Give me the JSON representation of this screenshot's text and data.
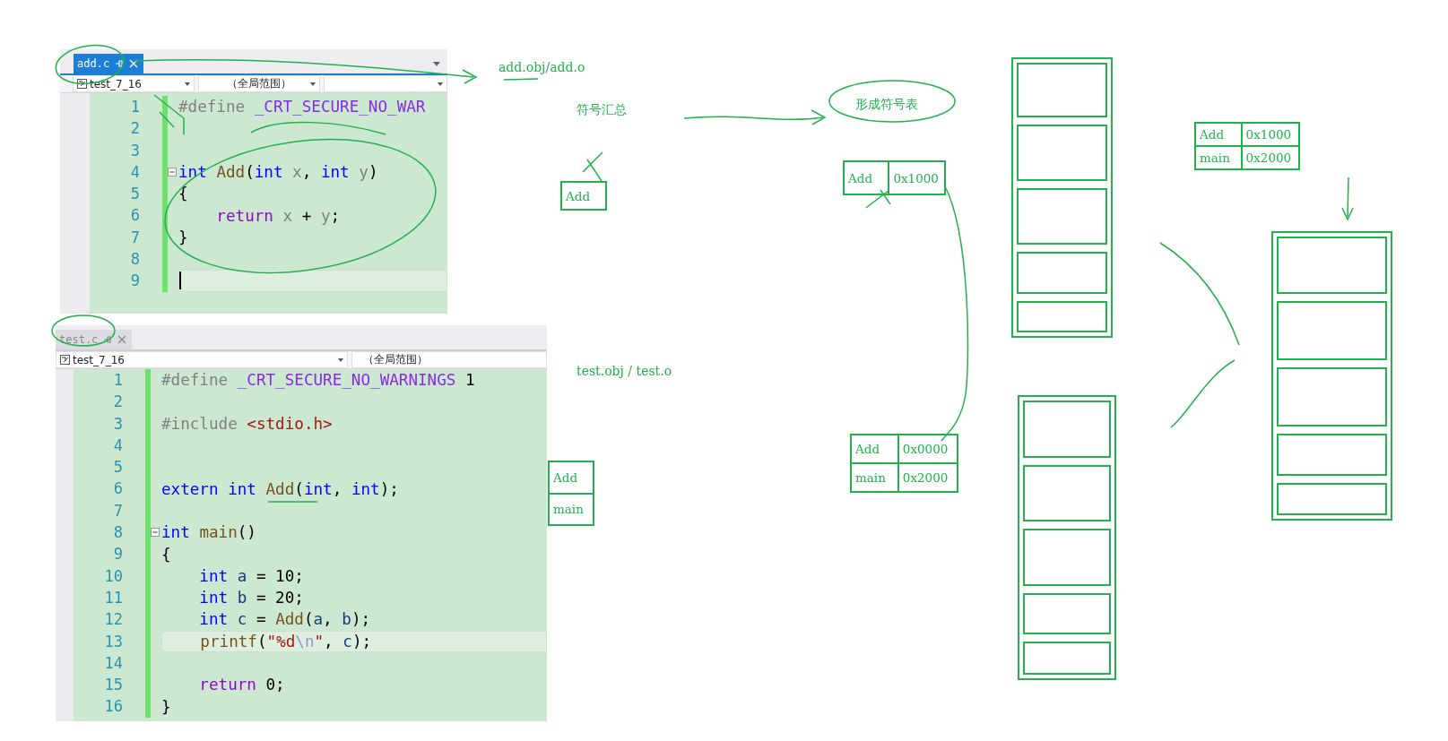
{
  "editors": [
    {
      "tab": {
        "label": "add.c",
        "selected": true
      },
      "project": "test_7_16",
      "scope": "（全局范围）",
      "third_dropdown": true,
      "lines": [
        {
          "number": "1",
          "tokens": [
            {
              "text": "#define ",
              "kind": "pre"
            },
            {
              "text": "_CRT_SECURE_NO_WAR",
              "kind": "macro"
            }
          ]
        },
        {
          "number": "2"
        },
        {
          "number": "3"
        },
        {
          "number": "4",
          "fold": true,
          "tokens": [
            {
              "text": "int ",
              "kind": "kw"
            },
            {
              "text": "Add",
              "kind": "fn"
            },
            {
              "text": "(",
              "kind": "plain"
            },
            {
              "text": "int",
              "kind": "kw"
            },
            {
              "text": " x",
              "kind": "param"
            },
            {
              "text": ", ",
              "kind": "plain"
            },
            {
              "text": "int",
              "kind": "kw"
            },
            {
              "text": " y",
              "kind": "param"
            },
            {
              "text": ")",
              "kind": "plain"
            }
          ]
        },
        {
          "number": "5",
          "tokens": [
            {
              "text": "{",
              "kind": "plain"
            }
          ]
        },
        {
          "number": "6",
          "tokens": [
            {
              "text": "    return",
              "kind": "ctl"
            },
            {
              "text": " x",
              "kind": "param"
            },
            {
              "text": " + ",
              "kind": "plain"
            },
            {
              "text": "y",
              "kind": "param"
            },
            {
              "text": ";",
              "kind": "plain"
            }
          ]
        },
        {
          "number": "7",
          "tokens": [
            {
              "text": "}",
              "kind": "plain"
            }
          ]
        },
        {
          "number": "8"
        },
        {
          "number": "9",
          "current": true
        }
      ]
    },
    {
      "tab": {
        "label": "test.c",
        "selected": false
      },
      "project": "test_7_16",
      "scope": "（全局范围）",
      "third_dropdown": false,
      "lines": [
        {
          "number": "1",
          "tokens": [
            {
              "text": "#define ",
              "kind": "pre"
            },
            {
              "text": "_CRT_SECURE_NO_WARNINGS",
              "kind": "macro"
            },
            {
              "text": " 1",
              "kind": "plain"
            }
          ]
        },
        {
          "number": "2"
        },
        {
          "number": "3",
          "tokens": [
            {
              "text": "#include ",
              "kind": "pre"
            },
            {
              "text": "<stdio.h>",
              "kind": "str"
            }
          ]
        },
        {
          "number": "4"
        },
        {
          "number": "5"
        },
        {
          "number": "6",
          "tokens": [
            {
              "text": "extern ",
              "kind": "kw"
            },
            {
              "text": "int ",
              "kind": "kw"
            },
            {
              "text": "Add",
              "kind": "fn"
            },
            {
              "text": "(",
              "kind": "plain"
            },
            {
              "text": "int",
              "kind": "kw"
            },
            {
              "text": ", ",
              "kind": "plain"
            },
            {
              "text": "int",
              "kind": "kw"
            },
            {
              "text": ");",
              "kind": "plain"
            }
          ]
        },
        {
          "number": "7"
        },
        {
          "number": "8",
          "fold": true,
          "tokens": [
            {
              "text": "int ",
              "kind": "kw"
            },
            {
              "text": "main",
              "kind": "fn"
            },
            {
              "text": "()",
              "kind": "plain"
            }
          ]
        },
        {
          "number": "9",
          "tokens": [
            {
              "text": "{",
              "kind": "plain"
            }
          ]
        },
        {
          "number": "10",
          "tokens": [
            {
              "text": "    int",
              "kind": "kw"
            },
            {
              "text": " a",
              "kind": "var"
            },
            {
              "text": " = 10;",
              "kind": "plain"
            }
          ]
        },
        {
          "number": "11",
          "tokens": [
            {
              "text": "    int",
              "kind": "kw"
            },
            {
              "text": " b",
              "kind": "var"
            },
            {
              "text": " = 20;",
              "kind": "plain"
            }
          ]
        },
        {
          "number": "12",
          "tokens": [
            {
              "text": "    int",
              "kind": "kw"
            },
            {
              "text": " c",
              "kind": "var"
            },
            {
              "text": " = ",
              "kind": "plain"
            },
            {
              "text": "Add",
              "kind": "fn"
            },
            {
              "text": "(",
              "kind": "plain"
            },
            {
              "text": "a",
              "kind": "var"
            },
            {
              "text": ", ",
              "kind": "plain"
            },
            {
              "text": "b",
              "kind": "var"
            },
            {
              "text": ");",
              "kind": "plain"
            }
          ]
        },
        {
          "number": "13",
          "current": true,
          "tokens": [
            {
              "text": "    printf",
              "kind": "fn"
            },
            {
              "text": "(",
              "kind": "plain"
            },
            {
              "text": "\"%d",
              "kind": "str"
            },
            {
              "text": "\\n",
              "kind": "esc"
            },
            {
              "text": "\"",
              "kind": "str"
            },
            {
              "text": ", ",
              "kind": "plain"
            },
            {
              "text": "c",
              "kind": "var"
            },
            {
              "text": ");",
              "kind": "plain"
            }
          ]
        },
        {
          "number": "14"
        },
        {
          "number": "15",
          "tokens": [
            {
              "text": "    return",
              "kind": "ctl"
            },
            {
              "text": " 0;",
              "kind": "plain"
            }
          ]
        },
        {
          "number": "16",
          "tokens": [
            {
              "text": "}",
              "kind": "plain"
            }
          ]
        }
      ]
    }
  ],
  "labels": [
    {
      "text": "add.obj/add.o"
    },
    {
      "text": "符号汇总"
    },
    {
      "text": "形成符号表"
    },
    {
      "text": "test.obj / test.o"
    }
  ],
  "tables": [
    {
      "rows": [
        [
          "Add"
        ]
      ]
    },
    {
      "rows": [
        [
          "Add",
          "0x1000"
        ]
      ]
    },
    {
      "rows": [
        [
          "Add",
          "0x0000"
        ],
        [
          "main",
          "0x2000"
        ]
      ]
    },
    {
      "rows": [
        [
          "Add",
          "0x1000"
        ],
        [
          "main",
          "0x2000"
        ]
      ]
    },
    {
      "rows": [
        [
          "Add"
        ],
        [
          "main"
        ]
      ]
    }
  ]
}
